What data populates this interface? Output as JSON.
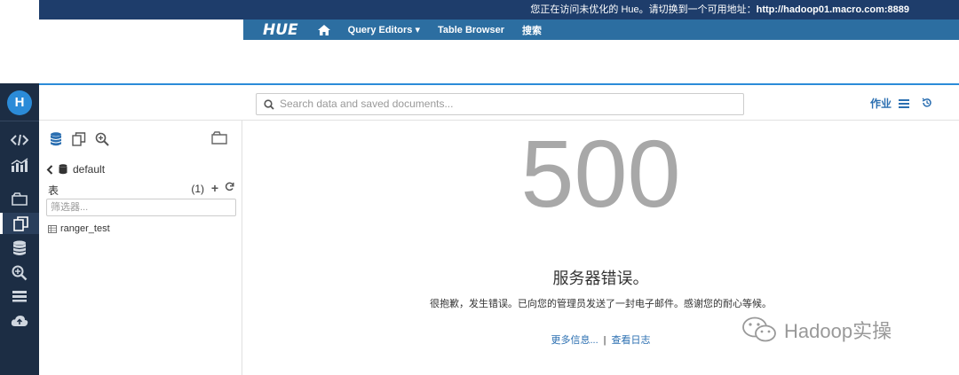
{
  "banner": {
    "message": "您正在访问未优化的 Hue。请切换到一个可用地址：",
    "url": "http://hadoop01.macro.com:8889"
  },
  "oldnav": {
    "logo": "HUE",
    "query_editors": "Query Editors ▾",
    "table_browser": "Table Browser",
    "search": "搜索"
  },
  "header": {
    "search_placeholder": "Search data and saved documents...",
    "jobs_label": "作业"
  },
  "leftbar": {
    "logo": "H"
  },
  "assist": {
    "database": "default",
    "tables_label": "表",
    "tables_count": "(1)",
    "filter_placeholder": "筛选器...",
    "tables": [
      "ranger_test"
    ]
  },
  "error": {
    "code": "500",
    "title": "服务器错误。",
    "message": "很抱歉，发生错误。已向您的管理员发送了一封电子邮件。感谢您的耐心等候。",
    "more_info": "更多信息...",
    "view_logs": "查看日志"
  },
  "watermark": {
    "text": "Hadoop实操"
  },
  "colors": {
    "banner_bg": "#1e3d6b",
    "nav_bg": "#2c6ea1",
    "sidebar_bg": "#1c2d44",
    "link": "#2b6fb1",
    "error_code": "#a8a8a8"
  }
}
